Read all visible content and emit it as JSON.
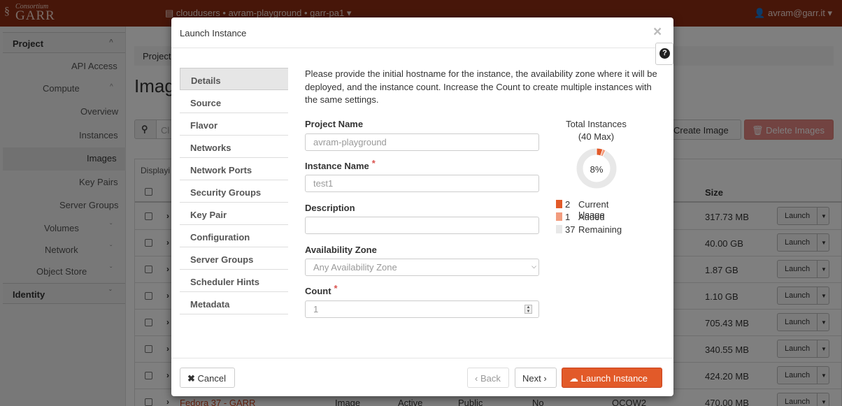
{
  "topbar": {
    "logo_small": "Consortium",
    "logo_big": "GARR",
    "project_picker": "cloudusers • avram-playground • garr-pa1",
    "user": "avram@garr.it"
  },
  "sidebar": {
    "project": "Project",
    "api_access": "API Access",
    "compute": "Compute",
    "overview": "Overview",
    "instances": "Instances",
    "images": "Images",
    "key_pairs": "Key Pairs",
    "server_groups": "Server Groups",
    "volumes": "Volumes",
    "network": "Network",
    "object_store": "Object Store",
    "identity": "Identity"
  },
  "main": {
    "breadcrumb": "Project",
    "page_title": "Imag",
    "search_placeholder": "Cl",
    "create_image": "Create Image",
    "delete_images": "Delete Images",
    "displaying": "Displayi",
    "size_header": "Size",
    "launch_label": "Launch",
    "rows": [
      {
        "size": "317.73 MB"
      },
      {
        "size": "40.00 GB"
      },
      {
        "size": "1.87 GB"
      },
      {
        "size": "1.10 GB"
      },
      {
        "size": "705.43 MB"
      },
      {
        "size": "340.55 MB"
      },
      {
        "size": "424.20 MB"
      },
      {
        "name": "Fedora 37 - GARR",
        "type": "Image",
        "status": "Active",
        "visibility": "Public",
        "protected": "No",
        "format": "QCOW2",
        "size": "470.00 MB"
      }
    ]
  },
  "modal": {
    "title": "Launch Instance",
    "close": "×",
    "help": "?",
    "nav": [
      "Details",
      "Source",
      "Flavor",
      "Networks",
      "Network Ports",
      "Security Groups",
      "Key Pair",
      "Configuration",
      "Server Groups",
      "Scheduler Hints",
      "Metadata"
    ],
    "intro": "Please provide the initial hostname for the instance, the availability zone where it will be deployed, and the instance count. Increase the Count to create multiple instances with the same settings.",
    "fields": {
      "project_name_label": "Project Name",
      "project_name_value": "avram-playground",
      "instance_name_label": "Instance Name",
      "instance_name_value": "test1",
      "description_label": "Description",
      "description_value": "",
      "availability_zone_label": "Availability Zone",
      "availability_zone_value": "Any Availability Zone",
      "count_label": "Count",
      "count_value": "1",
      "required_mark": "*"
    },
    "footer": {
      "cancel": "Cancel",
      "back": "Back",
      "next": "Next",
      "launch": "Launch Instance"
    }
  },
  "chart_data": {
    "type": "pie",
    "title": "Total Instances",
    "subtitle": "(40 Max)",
    "center_label": "8%",
    "max": 40,
    "series": [
      {
        "name": "Current Usage",
        "value": 2,
        "color": "#e25a29"
      },
      {
        "name": "Added",
        "value": 1,
        "color": "#f29c7e"
      },
      {
        "name": "Remaining",
        "value": 37,
        "color": "#e8e8e8"
      }
    ]
  },
  "colors": {
    "topbar": "#8f2d13",
    "accent": "#e25a29",
    "required": "#d9534f"
  }
}
